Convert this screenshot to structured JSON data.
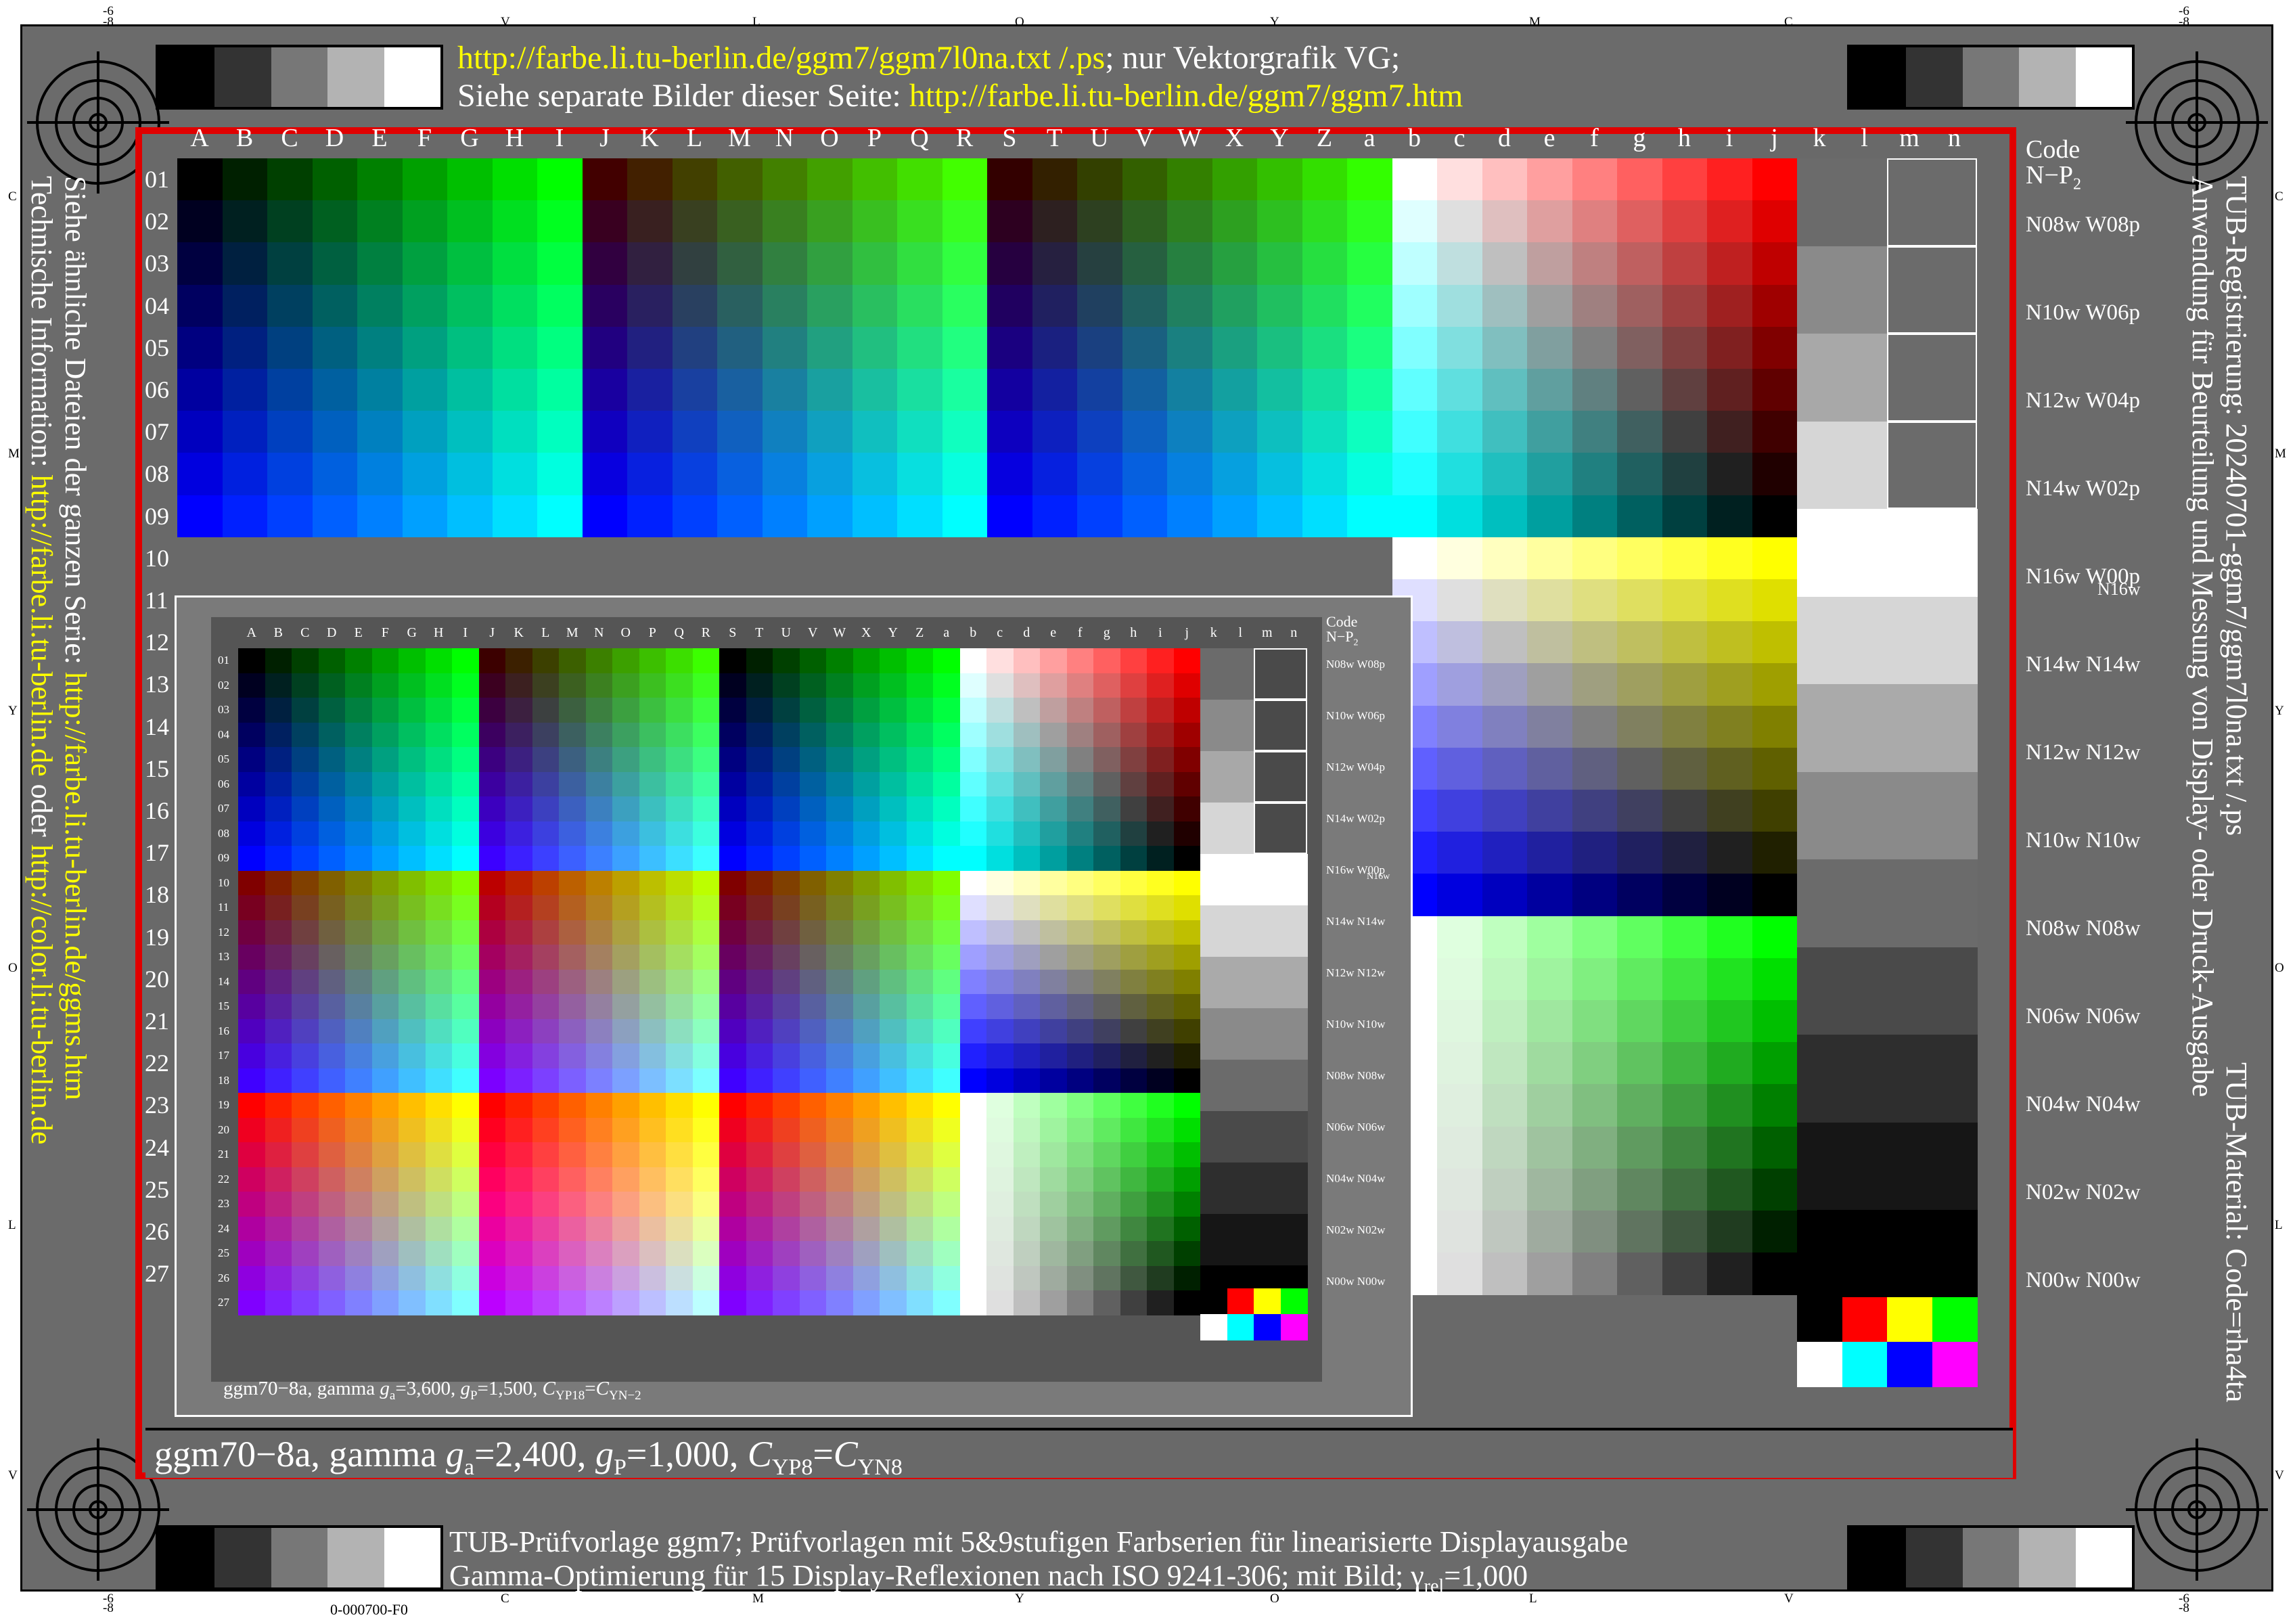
{
  "header": {
    "line1_link": "http://farbe.li.tu-berlin.de/ggm7/ggm7l0na.txt /.ps",
    "line1_rest": "; nur Vektorgrafik VG;",
    "line2_text": "Siehe separate Bilder dieser Seite: ",
    "line2_link": "http://farbe.li.tu-berlin.de/ggm7/ggm7.htm"
  },
  "ruler_top": [
    "-6",
    "-8",
    "V",
    "L",
    "O",
    "Y",
    "M",
    "C",
    "-6",
    "-8"
  ],
  "ruler_bottom": [
    "-6",
    "-8",
    "C",
    "M",
    "Y",
    "O",
    "L",
    "V",
    "-6",
    "-8"
  ],
  "ruler_side": [
    "C",
    "M",
    "Y",
    "O",
    "L",
    "V"
  ],
  "main_columns": [
    "A",
    "B",
    "C",
    "D",
    "E",
    "F",
    "G",
    "H",
    "I",
    "J",
    "K",
    "L",
    "M",
    "N",
    "O",
    "P",
    "Q",
    "R",
    "S",
    "T",
    "U",
    "V",
    "W",
    "X",
    "Y",
    "Z",
    "a",
    "b",
    "c",
    "d",
    "e",
    "f",
    "g",
    "h",
    "i",
    "j",
    "k",
    "l",
    "m",
    "n"
  ],
  "main_rows": [
    "01",
    "02",
    "03",
    "04",
    "05",
    "06",
    "07",
    "08",
    "09",
    "10",
    "11",
    "12",
    "13",
    "14",
    "15",
    "16",
    "17",
    "18",
    "19",
    "20",
    "21",
    "22",
    "23",
    "24",
    "25",
    "26",
    "27"
  ],
  "code_header": [
    "Code",
    "N−P"
  ],
  "code_header_sub": "2",
  "code_labels": [
    [
      "N08w",
      "W08p"
    ],
    [
      "N10w",
      "W06p"
    ],
    [
      "N12w",
      "W04p"
    ],
    [
      "N14w",
      "W02p"
    ],
    [
      "N16w",
      "W00p"
    ],
    [
      "N14w",
      "N14w"
    ],
    [
      "N12w",
      "N12w"
    ],
    [
      "N10w",
      "N10w"
    ],
    [
      "N08w",
      "N08w"
    ],
    [
      "N06w",
      "N06w"
    ],
    [
      "N04w",
      "N04w"
    ],
    [
      "N02w",
      "N02w"
    ],
    [
      "N00w",
      "N00w"
    ]
  ],
  "code_label_extra": "N16w",
  "small_caption": {
    "pre": "ggm70−8a, gamma ",
    "g": "g",
    "a_sub": "a",
    "mid": "=3,600, ",
    "g2": "g",
    "p_sub": "P",
    "mid2": "=1,500, ",
    "C": "C",
    "yp_sub": "YP18",
    "eq": "=",
    "C2": "C",
    "yn_sub": "YN−2"
  },
  "main_caption": {
    "pre": "ggm70−8a, gamma ",
    "g": "g",
    "a_sub": "a",
    "mid": "=2,400, ",
    "g2": "g",
    "p_sub": "P",
    "mid2": "=1,000, ",
    "C": "C",
    "yp_sub": "YP8",
    "eq": "=",
    "C2": "C",
    "yn_sub": "YN8"
  },
  "left_side": {
    "line1": "Siehe ähnliche Dateien der ganzen Serie: ",
    "line1_link": "http://farbe.li.tu-berlin.de/ggms.htm",
    "line2": "Technische Information: ",
    "line2_link": "http://farbe.li.tu-berlin.de",
    "line2_mid": " oder ",
    "line2_link2": "http://color.li.tu-berlin.de"
  },
  "right_side": {
    "line1": "TUB-Registrierung: 20240701-ggm7/ggm7l0na.txt /.ps",
    "line2": "Anwendung für Beurteilung und Messung von Display- oder Druck-Ausgabe",
    "line3": "TUB-Material: Code=rha4ta"
  },
  "footer": {
    "line1": "TUB-Prüfvorlage ggm7; Prüfvorlagen mit 5&9stufigen Farbserien für linearisierte Displayausgabe",
    "line2": "Gamma-Optimierung für 15 Display-Reflexionen nach ISO 9241-306; mit Bild; ",
    "gamma_sym": "γ",
    "gamma_sub": "rel",
    "gamma_val": "=1,000"
  },
  "bottom_code": "0-000700-F0",
  "colors": {
    "frame": "#6b6b6b",
    "red_border": "#e00000",
    "link": "#ffff00"
  }
}
